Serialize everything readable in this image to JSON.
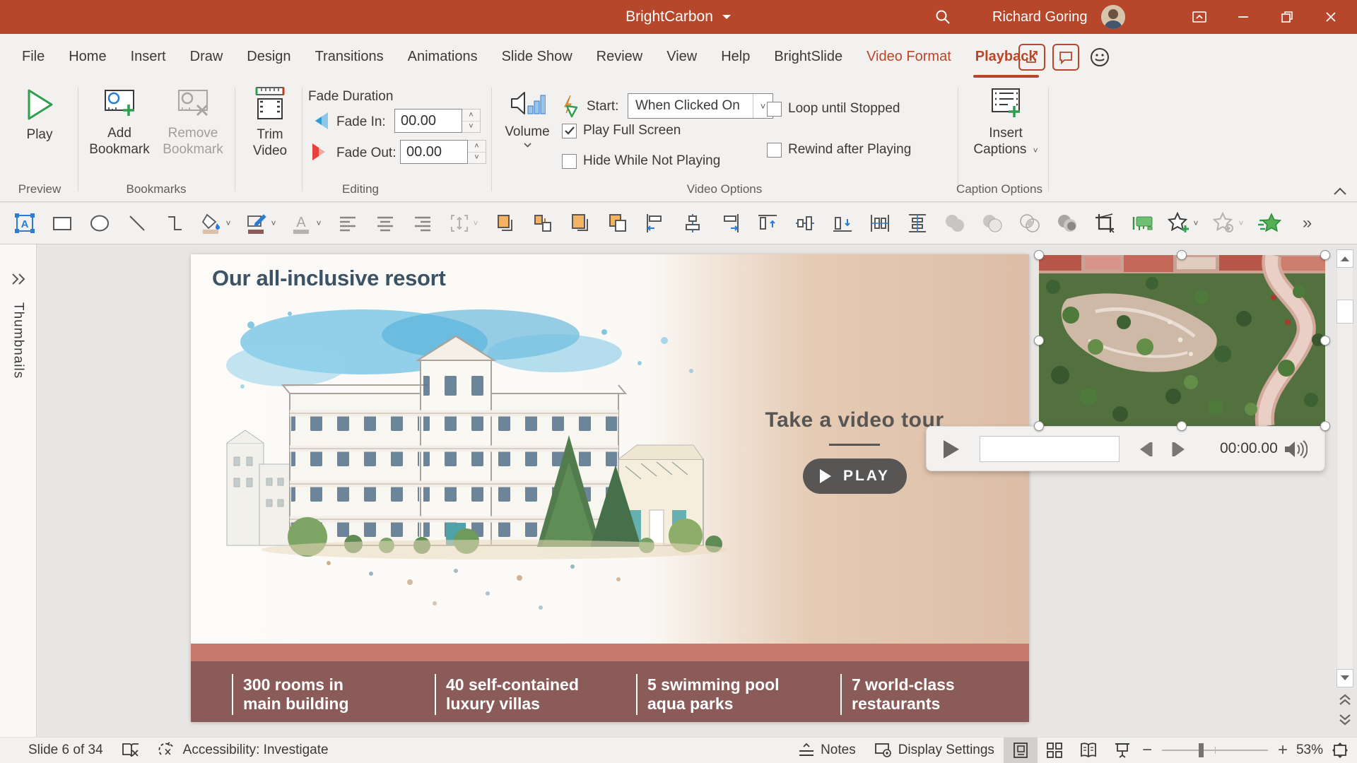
{
  "titlebar": {
    "app_menu": "BrightCarbon",
    "user_name": "Richard Goring"
  },
  "tabs": {
    "items": [
      "File",
      "Home",
      "Insert",
      "Draw",
      "Design",
      "Transitions",
      "Animations",
      "Slide Show",
      "Review",
      "View",
      "Help",
      "BrightSlide",
      "Video Format",
      "Playback"
    ],
    "active": "Playback",
    "contextual": "Video Format"
  },
  "ribbon": {
    "preview": {
      "play": "Play",
      "group": "Preview"
    },
    "bookmarks": {
      "add_line1": "Add",
      "add_line2": "Bookmark",
      "remove_line1": "Remove",
      "remove_line2": "Bookmark",
      "group": "Bookmarks"
    },
    "trim": {
      "line1": "Trim",
      "line2": "Video"
    },
    "editing": {
      "header": "Fade Duration",
      "fade_in": "Fade In:",
      "fade_in_value": "00.00",
      "fade_out": "Fade Out:",
      "fade_out_value": "00.00",
      "group": "Editing"
    },
    "volume": {
      "label": "Volume"
    },
    "video_options": {
      "start": "Start:",
      "start_value": "When Clicked On",
      "cb_fullscreen": "Play Full Screen",
      "fullscreen_checked": true,
      "cb_hide": "Hide While Not Playing",
      "hide_checked": false,
      "cb_loop": "Loop until Stopped",
      "loop_checked": false,
      "cb_rewind": "Rewind after Playing",
      "rewind_checked": false,
      "group": "Video Options"
    },
    "captions": {
      "line1": "Insert",
      "line2": "Captions",
      "group": "Caption Options"
    }
  },
  "toolbar": {
    "icons": [
      "text-box-icon",
      "rectangle-icon",
      "oval-icon",
      "line-icon",
      "elbow-connector-icon",
      "fill-color-icon",
      "outline-color-icon",
      "font-color-icon",
      "align-text-left-icon",
      "align-text-center-icon",
      "align-text-right-icon",
      "autofit-icon",
      "bring-forward-icon",
      "send-backward-icon",
      "bring-to-front-icon",
      "send-to-back-icon",
      "align-objects-left-icon",
      "align-objects-center-icon",
      "align-objects-right-icon",
      "align-objects-top-icon",
      "align-objects-middle-icon",
      "align-objects-bottom-icon",
      "distribute-horizontally-icon",
      "distribute-vertically-icon",
      "merge-union-icon",
      "merge-combine-icon",
      "merge-intersect-icon",
      "merge-subtract-icon",
      "crop-icon",
      "callout-icon",
      "add-star-icon",
      "star-settings-icon",
      "animation-star-icon",
      "more-tools-icon"
    ]
  },
  "panel": {
    "thumbnails": "Thumbnails"
  },
  "slide": {
    "title": "Our all-inclusive resort",
    "video_heading": "Take a video tour",
    "play_button": "PLAY",
    "stats": [
      {
        "l1": "300 rooms in",
        "l2": "main building"
      },
      {
        "l1": "40 self-contained",
        "l2": "luxury villas"
      },
      {
        "l1": "5 swimming pool",
        "l2": "aqua parks"
      },
      {
        "l1": "7 world-class",
        "l2": "restaurants"
      }
    ]
  },
  "player": {
    "time": "00:00.00"
  },
  "statusbar": {
    "slide": "Slide 6 of 34",
    "accessibility": "Accessibility: Investigate",
    "notes": "Notes",
    "display": "Display Settings",
    "zoom": "53%"
  },
  "colors": {
    "titlebar": "#B7472A",
    "accent_red": "#B7472A",
    "slide_tan": "#DDBFA8",
    "band_maroon": "#8A5B58",
    "band_salmon": "#C8796D",
    "title_text": "#3C5265"
  }
}
